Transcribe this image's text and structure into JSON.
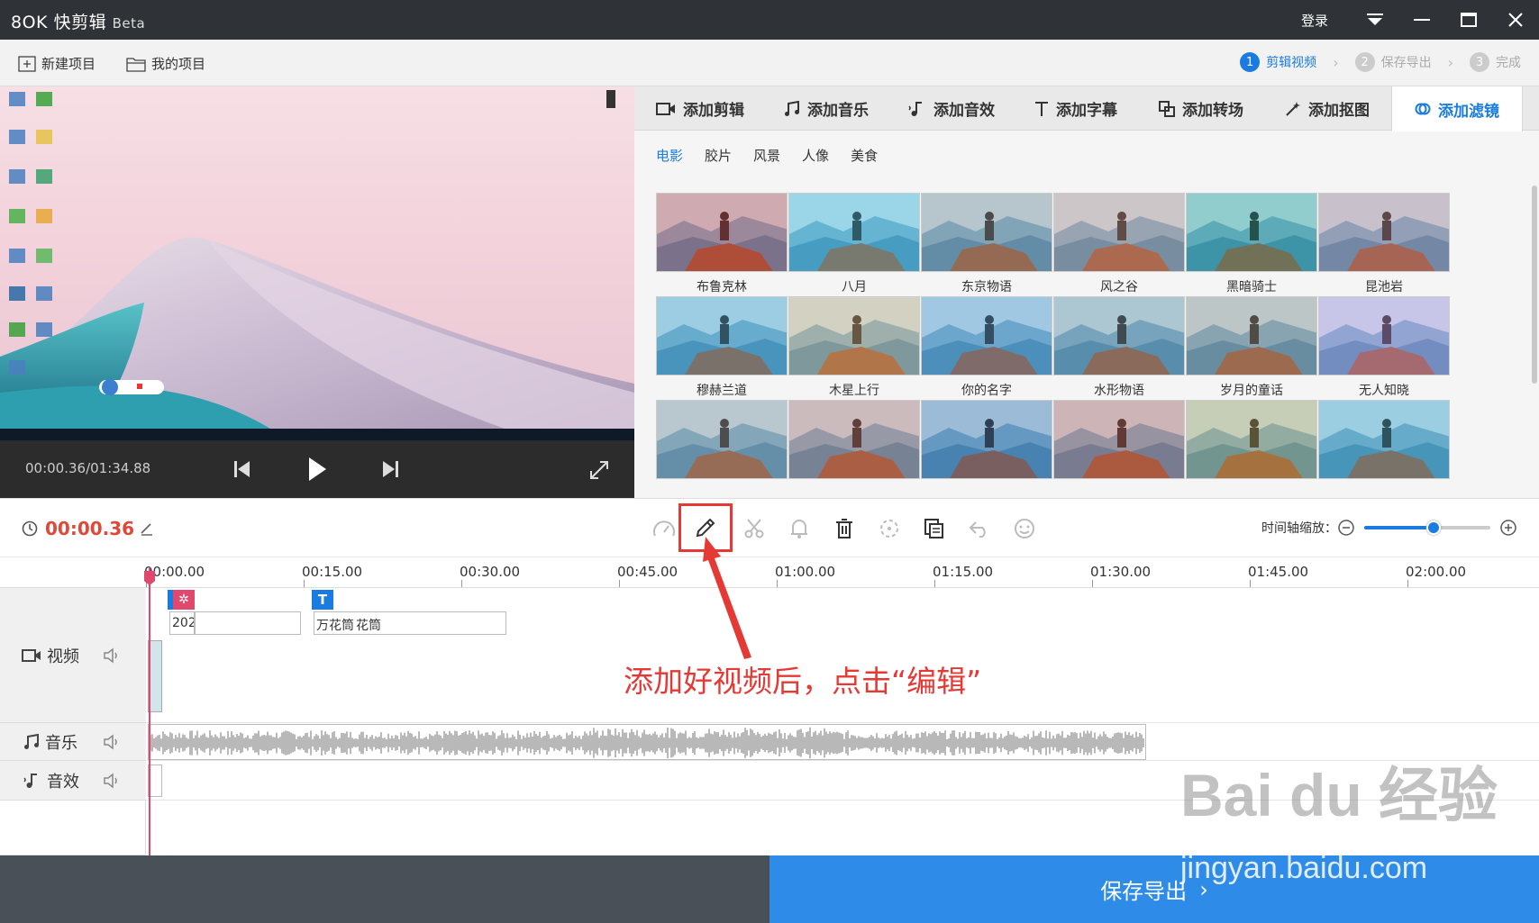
{
  "app": {
    "name": "快剪辑",
    "logo": "8OK",
    "beta": "Beta",
    "login": "登录"
  },
  "menu": {
    "new_project": "新建项目",
    "my_projects": "我的项目"
  },
  "steps": [
    {
      "num": "1",
      "label": "剪辑视频",
      "active": true
    },
    {
      "num": "2",
      "label": "保存导出",
      "active": false
    },
    {
      "num": "3",
      "label": "完成",
      "active": false
    }
  ],
  "player": {
    "timecode": "00:00.36/01:34.88"
  },
  "panel_tabs": [
    {
      "label": "添加剪辑",
      "icon": "video-camera-icon"
    },
    {
      "label": "添加音乐",
      "icon": "music-note-icon"
    },
    {
      "label": "添加音效",
      "icon": "sound-effect-icon"
    },
    {
      "label": "添加字幕",
      "icon": "text-t-icon"
    },
    {
      "label": "添加转场",
      "icon": "transition-icon"
    },
    {
      "label": "添加抠图",
      "icon": "magic-wand-icon"
    },
    {
      "label": "添加滤镜",
      "icon": "filter-icon",
      "active": true
    }
  ],
  "filter_subtabs": [
    {
      "label": "电影",
      "active": true
    },
    {
      "label": "胶片"
    },
    {
      "label": "风景"
    },
    {
      "label": "人像"
    },
    {
      "label": "美食"
    }
  ],
  "filters": [
    {
      "label": "布鲁克林",
      "tint": "#d23a3a"
    },
    {
      "label": "八月",
      "tint": "#37b7d8"
    },
    {
      "label": "东京物语",
      "tint": "#8a8a8a"
    },
    {
      "label": "风之谷",
      "tint": "#c98a7a"
    },
    {
      "label": "黑暗骑士",
      "tint": "#1f9e8c"
    },
    {
      "label": "昆池岩",
      "tint": "#b97a86"
    },
    {
      "label": "穆赫兰道",
      "tint": "#3c9fc8"
    },
    {
      "label": "木星上行",
      "tint": "#d9a86a"
    },
    {
      "label": "你的名字",
      "tint": "#4a8fc6"
    },
    {
      "label": "水形物语",
      "tint": "#6a8a98"
    },
    {
      "label": "岁月的童话",
      "tint": "#9a8a78"
    },
    {
      "label": "无人知晓",
      "tint": "#b78ad6"
    },
    {
      "label": "",
      "tint": "#8f8f8f"
    },
    {
      "label": "",
      "tint": "#c66a5a"
    },
    {
      "label": "",
      "tint": "#3a6aa6"
    },
    {
      "label": "",
      "tint": "#c85a4a"
    },
    {
      "label": "",
      "tint": "#b8a04a"
    },
    {
      "label": "",
      "tint": "#3aa0c0"
    }
  ],
  "toolbar": {
    "current_time": "00:00.36",
    "zoom_label": "时间轴缩放：",
    "zoom_level": 0.55
  },
  "ruler": [
    "00:00.00",
    "00:15.00",
    "00:30.00",
    "00:45.00",
    "01:00.00",
    "01:15.00",
    "01:30.00",
    "01:45.00",
    "02:00.00"
  ],
  "tracks": {
    "video": "视频",
    "music": "音乐",
    "sfx": "音效",
    "subtitle_clip_1": "202",
    "subtitle_clip_2": "万花筒",
    "subtitle_clip_3": "花筒"
  },
  "annotation": "添加好视频后，点击“编辑”",
  "export_button": "保存导出",
  "watermark": {
    "brand": "Bai du 经验",
    "url": "jingyan.baidu.com"
  },
  "colors": {
    "accent": "#1a7ce0",
    "highlight": "#e53935",
    "timecode": "#e0483a"
  }
}
